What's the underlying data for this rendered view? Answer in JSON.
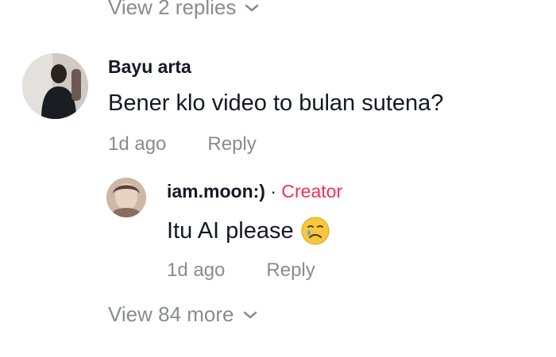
{
  "top_link": {
    "label": "View 2 replies",
    "icon": "chevron-down-icon"
  },
  "main_comment": {
    "author": "Bayu arta",
    "text": "Bener klo video to bulan sutena?",
    "time": "1d ago",
    "reply_label": "Reply"
  },
  "reply_comment": {
    "author": "iam.moon:)",
    "separator": "·",
    "badge": "Creator",
    "text": "Itu AI please",
    "emoji": "crying-face-icon",
    "time": "1d ago",
    "reply_label": "Reply"
  },
  "bottom_link": {
    "label": "View 84 more",
    "icon": "chevron-down-icon"
  },
  "colors": {
    "text_primary": "#161823",
    "text_secondary": "#8a8b91",
    "creator_accent": "#fe2c55"
  }
}
